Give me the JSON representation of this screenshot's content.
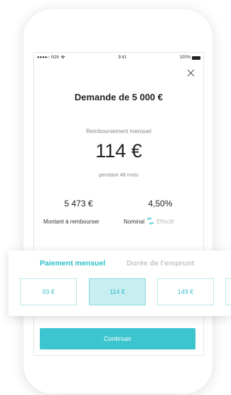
{
  "status_bar": {
    "carrier": "●●●●○ N26",
    "time": "9:41",
    "battery_pct": "100%"
  },
  "loan": {
    "title": "Demande de 5 000 €",
    "monthly_label": "Remboursement mensuel",
    "monthly_amount": "114 €",
    "duration": "pendant 48 mois",
    "total_value": "5 473 €",
    "total_label": "Montant à rembourser",
    "rate_value": "4,50%",
    "rate_nominal": "Nominal",
    "rate_effective": "Effectif"
  },
  "tabs": {
    "monthly": "Paiement mensuel",
    "duration": "Durée de l'emprunt"
  },
  "payment_options": [
    {
      "label": "93 €"
    },
    {
      "label": "114 €"
    },
    {
      "label": "149 €"
    }
  ],
  "continue_label": "Continuer",
  "colors": {
    "accent": "#3cc5cf",
    "selected_bg": "#c8eef1"
  }
}
